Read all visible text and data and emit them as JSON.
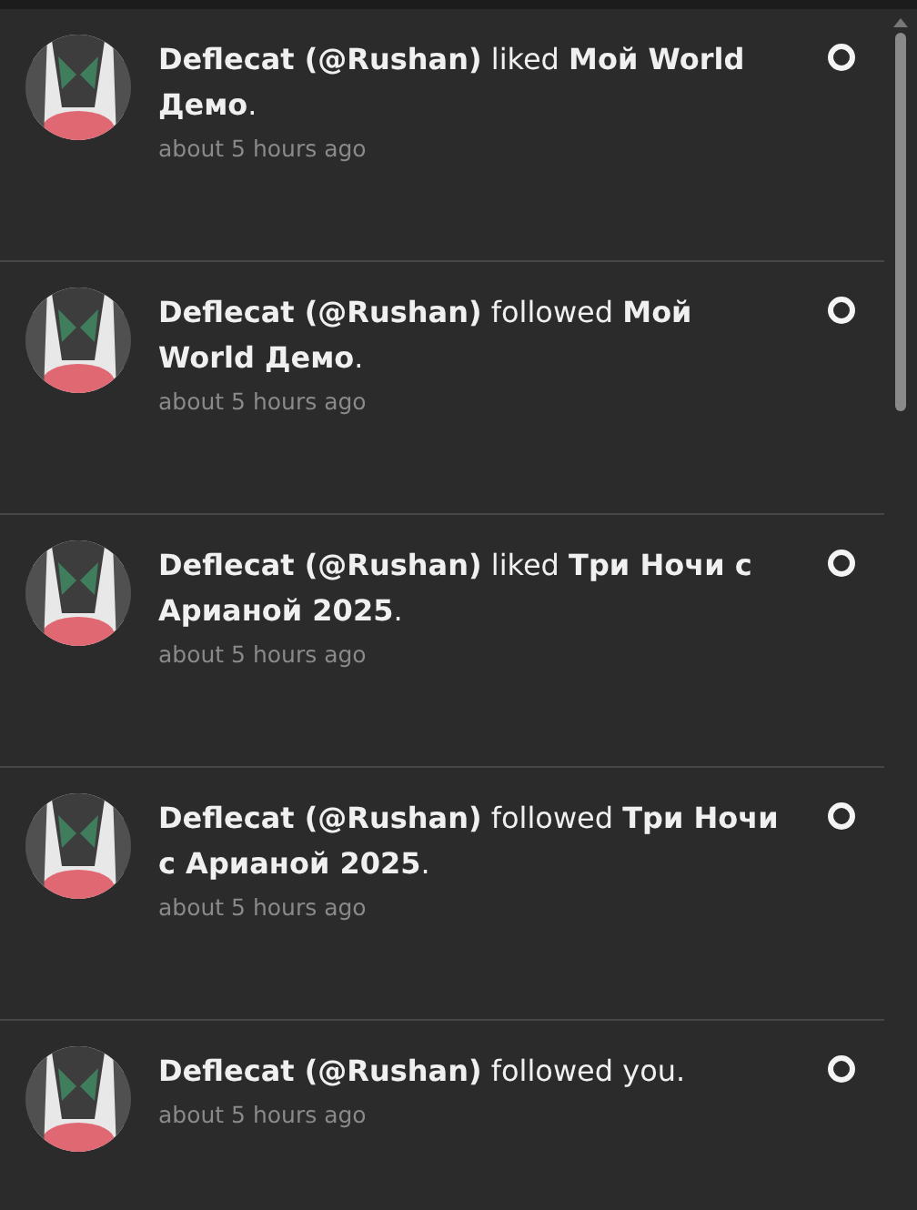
{
  "notifications": [
    {
      "text": "**Deflecat (@Rushan)** liked **Мой World Демо**.",
      "time": "about 5 hours ago",
      "read": false
    },
    {
      "text": "**Deflecat (@Rushan)** followed **Мой World Демо**.",
      "time": "about 5 hours ago",
      "read": false
    },
    {
      "text": "**Deflecat (@Rushan)** liked **Три Ночи с Арианой 2025**.",
      "time": "about 5 hours ago",
      "read": false
    },
    {
      "text": "**Deflecat (@Rushan)** followed **Три Ночи с Арианой 2025**.",
      "time": "about 5 hours ago",
      "read": false
    },
    {
      "text": "**Deflecat (@Rushan)** followed you.",
      "time": "about 5 hours ago",
      "read": false
    }
  ]
}
